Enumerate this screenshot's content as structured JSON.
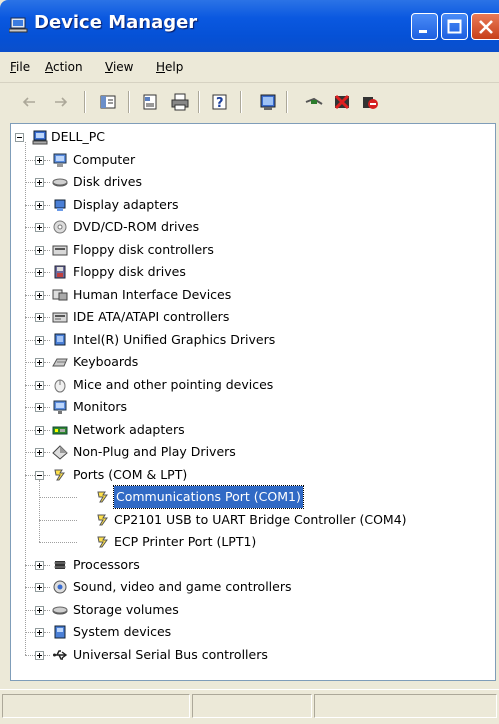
{
  "window": {
    "title": "Device Manager"
  },
  "menu": [
    "File",
    "Action",
    "View",
    "Help"
  ],
  "menu_mnemonic": [
    "F",
    "A",
    "V",
    "H"
  ],
  "toolbar": {
    "icons": [
      "back-icon",
      "forward-icon",
      "properties-view-icon",
      "properties-icon",
      "print-icon",
      "help-icon",
      "scan-hardware-icon",
      "update-driver-icon",
      "uninstall-icon",
      "disable-icon"
    ]
  },
  "tree": {
    "root": "DELL_PC",
    "categories": [
      {
        "label": "Computer",
        "icon": "computer-icon"
      },
      {
        "label": "Disk drives",
        "icon": "disk-drive-icon"
      },
      {
        "label": "Display adapters",
        "icon": "display-adapter-icon"
      },
      {
        "label": "DVD/CD-ROM drives",
        "icon": "dvd-drive-icon"
      },
      {
        "label": "Floppy disk controllers",
        "icon": "floppy-controller-icon"
      },
      {
        "label": "Floppy disk drives",
        "icon": "floppy-drive-icon"
      },
      {
        "label": "Human Interface Devices",
        "icon": "hid-icon"
      },
      {
        "label": "IDE ATA/ATAPI controllers",
        "icon": "ide-controller-icon"
      },
      {
        "label": "Intel(R) Unified Graphics Drivers",
        "icon": "graphics-driver-icon"
      },
      {
        "label": "Keyboards",
        "icon": "keyboard-icon"
      },
      {
        "label": "Mice and other pointing devices",
        "icon": "mouse-icon"
      },
      {
        "label": "Monitors",
        "icon": "monitor-icon"
      },
      {
        "label": "Network adapters",
        "icon": "network-adapter-icon"
      },
      {
        "label": "Non-Plug and Play Drivers",
        "icon": "non-pnp-icon"
      },
      {
        "label": "Ports (COM & LPT)",
        "icon": "port-icon",
        "expanded": true,
        "children": [
          {
            "label": "Communications Port (COM1)",
            "icon": "port-icon",
            "selected": true
          },
          {
            "label": "CP2101 USB to UART Bridge Controller (COM4)",
            "icon": "port-icon"
          },
          {
            "label": "ECP Printer Port (LPT1)",
            "icon": "port-icon"
          }
        ]
      },
      {
        "label": "Processors",
        "icon": "processor-icon"
      },
      {
        "label": "Sound, video and game controllers",
        "icon": "sound-icon"
      },
      {
        "label": "Storage volumes",
        "icon": "storage-volume-icon"
      },
      {
        "label": "System devices",
        "icon": "system-device-icon"
      },
      {
        "label": "Universal Serial Bus controllers",
        "icon": "usb-icon"
      }
    ]
  }
}
